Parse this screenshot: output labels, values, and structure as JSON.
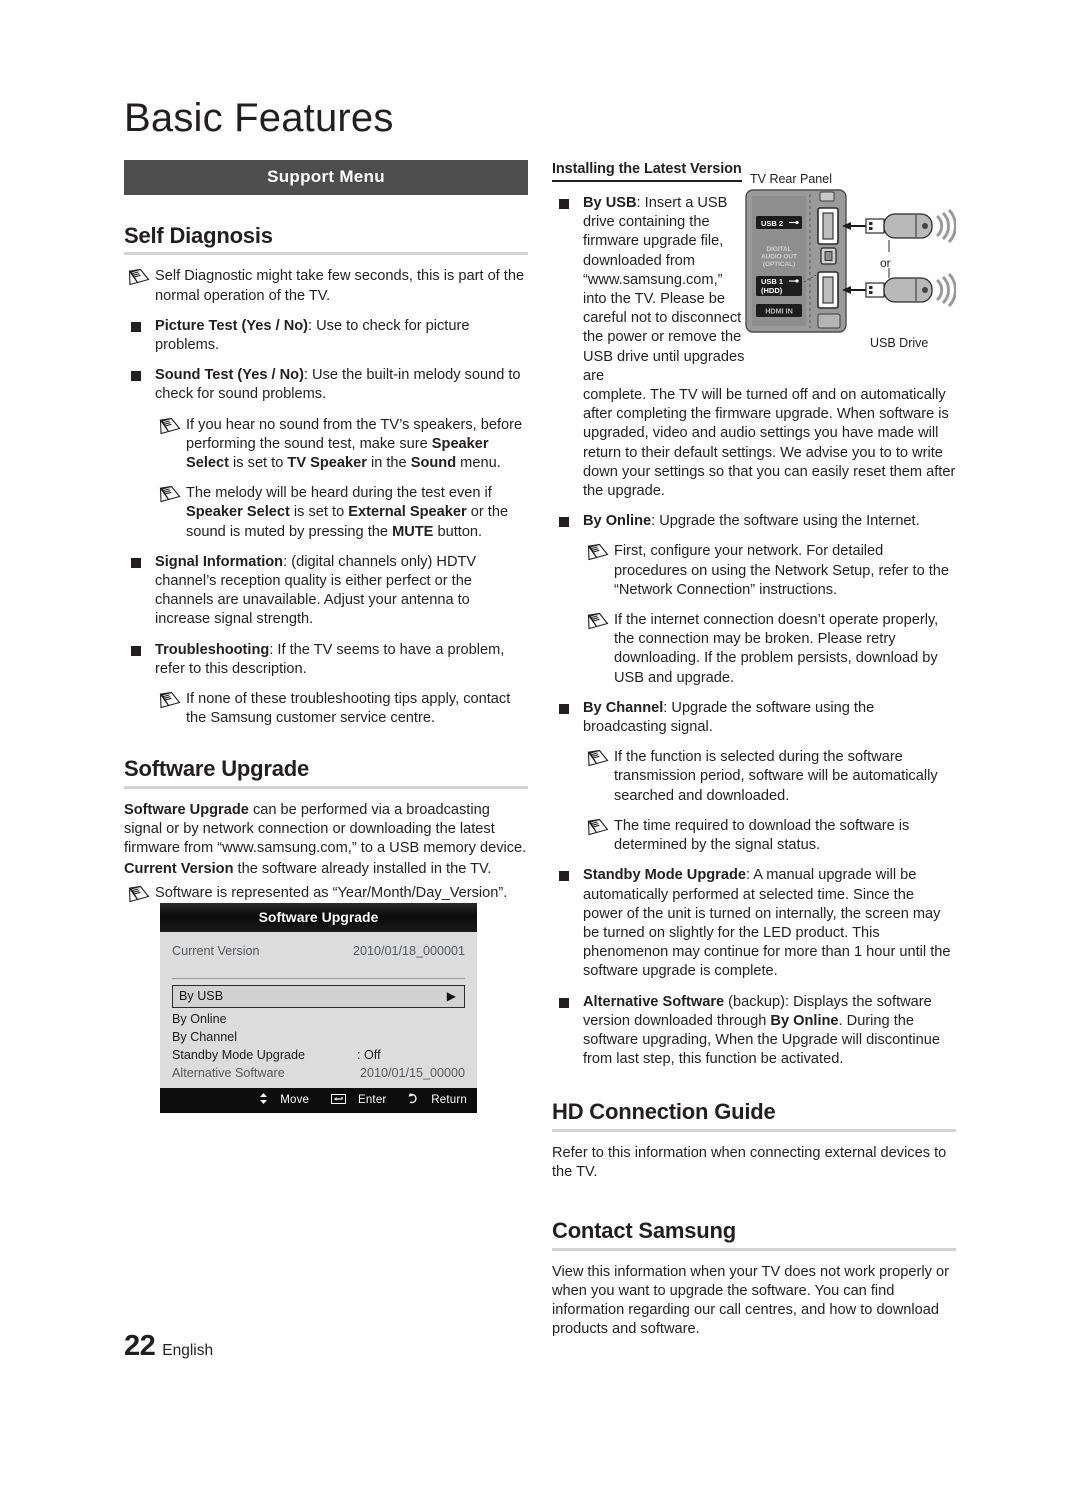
{
  "page": {
    "title": "Basic Features",
    "footer": {
      "number": "22",
      "language": "English"
    }
  },
  "band": {
    "label": "Support Menu"
  },
  "left": {
    "self_diagnosis": {
      "heading": "Self Diagnosis",
      "note_intro": "Self Diagnostic might take few seconds, this is part of the normal operation of the TV.",
      "items": [
        {
          "term": "Picture Test (Yes / No)",
          "sep": ":",
          "text": " Use to check for picture problems."
        },
        {
          "term": "Sound Test (Yes / No)",
          "sep": ":",
          "text": " Use the built-in melody sound to check for sound problems."
        }
      ],
      "sound_notes": [
        {
          "a": "If you hear no sound from the TV’s speakers, before performing the sound test, make sure ",
          "b1": "Speaker Select",
          "c": " is set to ",
          "b2": "TV Speaker",
          "d": " in the ",
          "b3": "Sound",
          "e": " menu."
        },
        {
          "a": "The melody will be heard during the test even if ",
          "b1": "Speaker Select",
          "c": " is set to ",
          "b2": "External Speaker",
          "d": " or the sound is muted by pressing the ",
          "b3": "MUTE",
          "e": " button."
        }
      ],
      "items2": [
        {
          "term": "Signal Information",
          "sep": ":",
          "text": " (digital channels only) HDTV channel’s reception quality is either perfect or the channels are unavailable. Adjust your antenna to increase signal strength."
        },
        {
          "term": "Troubleshooting",
          "sep": ":",
          "text": " If the TV seems to have a problem, refer to this description."
        }
      ],
      "trouble_note": "If none of these troubleshooting tips apply, contact the Samsung customer service centre."
    },
    "software_upgrade": {
      "heading": "Software Upgrade",
      "para1_bold": "Software Upgrade",
      "para1_rest": " can be performed via a broadcasting signal or by network connection or downloading the latest firmware from “www.samsung.com,” to a USB memory device.",
      "para2_bold": "Current Version",
      "para2_rest": " the software already installed in the TV.",
      "note": "Software is represented as “Year/Month/Day_Version”."
    },
    "osd": {
      "title": "Software Upgrade",
      "current_version_label": "Current Version",
      "current_version_value": "2010/01/18_000001",
      "highlight_label": "By USB",
      "highlight_arrow": "▶",
      "rows": [
        {
          "label": "By Online",
          "value": ""
        },
        {
          "label": "By Channel",
          "value": ""
        },
        {
          "label": "Standby Mode Upgrade",
          "value": ": Off"
        }
      ],
      "dim_row": {
        "label": "Alternative Software",
        "value": "2010/01/15_00000"
      },
      "footer": {
        "move": "Move",
        "enter": "Enter",
        "return": "Return"
      }
    }
  },
  "right": {
    "installing": {
      "subheading": "Installing the Latest Version",
      "by_usb": {
        "term": "By USB",
        "sep": ":",
        "text_narrow": " Insert a USB drive containing the firmware upgrade file, downloaded from “www.samsung.com,” into the TV. Please be careful not to disconnect the power or remove the USB drive until upgrades are",
        "text_wide": "complete. The TV will be turned off and on automatically after completing the firmware upgrade. When software is upgraded, video and audio settings you have made will return to their default settings. We advise you to to write down your settings so that you can easily reset them after the upgrade."
      },
      "by_online": {
        "term": "By Online",
        "sep": ":",
        "text": " Upgrade the software using the Internet."
      },
      "by_online_notes": [
        "First, configure your network. For detailed procedures on using the Network Setup, refer to the “Network Connection” instructions.",
        "If the internet connection doesn’t operate properly, the connection may be broken. Please retry downloading. If the problem persists, download by USB and upgrade."
      ],
      "by_channel": {
        "term": "By Channel",
        "sep": ":",
        "text": " Upgrade the software using the broadcasting signal."
      },
      "by_channel_notes": [
        "If the function is selected during the software transmission period, software will be automatically searched and downloaded.",
        "The time required to download the software is determined by the signal status."
      ],
      "standby": {
        "term": "Standby Mode Upgrade",
        "sep": ":",
        "text": " A manual upgrade will be automatically performed at selected time. Since the power of the unit is turned on internally, the screen may be turned on slightly for the LED product. This phenomenon may continue for more than 1 hour until the software upgrade is complete."
      },
      "alternative": {
        "term": "Alternative Software",
        "mid": " (backup): Displays the software version downloaded through ",
        "bold2": "By Online",
        "rest": ". During the software upgrading, When the Upgrade will discontinue from last step, this function be activated."
      }
    },
    "hd_guide": {
      "heading": "HD Connection Guide",
      "text": "Refer to this information when connecting external devices to the TV."
    },
    "contact": {
      "heading": "Contact Samsung",
      "text": "View this information when your TV does not work properly or when you want to upgrade the software. You can find information regarding our call centres, and how to download products and software."
    }
  },
  "diagram": {
    "caption_top": "TV Rear Panel",
    "caption_bottom": "USB Drive",
    "or": "or",
    "port_usb2": "USB 2",
    "port_digital_l1": "DIGITAL",
    "port_digital_l2": "AUDIO OUT",
    "port_digital_l3": "(OPTICAL)",
    "port_usb1_l1": "USB 1",
    "port_usb1_l2": "(HDD)",
    "port_hdmi": "HDMI IN"
  },
  "colors": {
    "band": "#4d4d4d",
    "rule": "#d3d3d3",
    "ink": "#231f20",
    "osd_body": "#dcdcdc"
  }
}
